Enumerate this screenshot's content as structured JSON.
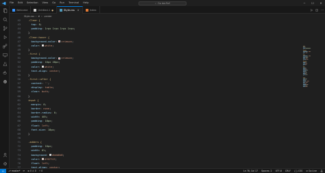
{
  "titlebar": {
    "menu": [
      "File",
      "Edit",
      "Selection",
      "View",
      "Go",
      "Run",
      "Terminal",
      "Help"
    ],
    "search_placeholder": "Go dar.Ref"
  },
  "tabs": [
    {
      "label": "Welcome",
      "color": "#3794ff",
      "modified": false,
      "active": false
    },
    {
      "label": "Untitled-1",
      "color": "#cccccc",
      "modified": true,
      "active": false
    },
    {
      "label": "Style.css",
      "color": "#519aba",
      "modified": false,
      "active": true
    },
    {
      "label": "Index",
      "color": "#e37933",
      "modified": false,
      "active": false
    }
  ],
  "breadcrumb": [
    "Style.css",
    "#",
    ".center"
  ],
  "editor": {
    "current_line": 78,
    "lines": [
      {
        "n": 42,
        "tokens": [
          [
            "sel",
            ".Clear {"
          ]
        ]
      },
      {
        "n": 43,
        "tokens": [
          [
            "prop",
            "  top"
          ],
          [
            "punc",
            ": "
          ],
          [
            "num",
            "0"
          ],
          [
            "punc",
            ";"
          ]
        ]
      },
      {
        "n": 44,
        "tokens": [
          [
            "prop",
            "  padding"
          ],
          [
            "punc",
            ": "
          ],
          [
            "num",
            "1rpx 1rpx 1rpx 1rpx"
          ],
          [
            "punc",
            ";"
          ]
        ]
      },
      {
        "n": 45,
        "tokens": [
          [
            "punc",
            "}"
          ]
        ]
      },
      {
        "n": 46,
        "tokens": [
          [
            "sel",
            ".Clear:hover {"
          ]
        ]
      },
      {
        "n": 47,
        "tokens": [
          [
            "prop",
            "  background-color"
          ],
          [
            "punc",
            ": "
          ],
          [
            "swatch",
            "#e13c3c"
          ],
          [
            "val",
            "crimson"
          ],
          [
            "punc",
            ";"
          ]
        ]
      },
      {
        "n": 48,
        "tokens": [
          [
            "prop",
            "  color"
          ],
          [
            "punc",
            ": "
          ],
          [
            "swatch",
            "#ffffff"
          ],
          [
            "val",
            "white"
          ],
          [
            "punc",
            ";"
          ]
        ]
      },
      {
        "n": 49,
        "tokens": [
          [
            "punc",
            "}"
          ]
        ]
      },
      {
        "n": 50,
        "tokens": [
          [
            "sel",
            ".first {"
          ]
        ]
      },
      {
        "n": 51,
        "tokens": [
          [
            "prop",
            "  background-color"
          ],
          [
            "punc",
            ": "
          ],
          [
            "swatch",
            "#e13c3c"
          ],
          [
            "val",
            "crimson"
          ],
          [
            "punc",
            ";"
          ]
        ]
      },
      {
        "n": 52,
        "tokens": [
          [
            "prop",
            "  padding"
          ],
          [
            "punc",
            ": "
          ],
          [
            "num",
            "10px 40px"
          ],
          [
            "punc",
            ";"
          ]
        ]
      },
      {
        "n": 53,
        "tokens": [
          [
            "prop",
            "  color"
          ],
          [
            "punc",
            ": "
          ],
          [
            "swatch",
            "#ffffff"
          ],
          [
            "val",
            "white"
          ],
          [
            "punc",
            ";"
          ]
        ]
      },
      {
        "n": 54,
        "tokens": [
          [
            "prop",
            "  text-align"
          ],
          [
            "punc",
            ": "
          ],
          [
            "val",
            "center"
          ],
          [
            "punc",
            ";"
          ]
        ]
      },
      {
        "n": 55,
        "tokens": [
          [
            "punc",
            "}"
          ]
        ]
      },
      {
        "n": 56,
        "tokens": [
          [
            "sel",
            ".first::after {"
          ]
        ]
      },
      {
        "n": 57,
        "tokens": [
          [
            "prop",
            "  content"
          ],
          [
            "punc",
            ": "
          ],
          [
            "val",
            "''"
          ],
          [
            "punc",
            ";"
          ]
        ]
      },
      {
        "n": 58,
        "tokens": [
          [
            "prop",
            "  display"
          ],
          [
            "punc",
            ": "
          ],
          [
            "val",
            "table"
          ],
          [
            "punc",
            ";"
          ]
        ]
      },
      {
        "n": 59,
        "tokens": [
          [
            "prop",
            "  clear"
          ],
          [
            "punc",
            ": "
          ],
          [
            "val",
            "both"
          ],
          [
            "punc",
            ";"
          ]
        ]
      },
      {
        "n": 60,
        "tokens": [
          [
            "punc",
            "}"
          ]
        ]
      },
      {
        "n": 61,
        "tokens": [
          [
            "sel",
            "input {"
          ]
        ]
      },
      {
        "n": 62,
        "tokens": [
          [
            "prop",
            "  margin"
          ],
          [
            "punc",
            ": "
          ],
          [
            "num",
            "0"
          ],
          [
            "punc",
            ";"
          ]
        ]
      },
      {
        "n": 63,
        "tokens": [
          [
            "prop",
            "  border"
          ],
          [
            "punc",
            ": "
          ],
          [
            "val",
            "none"
          ],
          [
            "punc",
            ";"
          ]
        ]
      },
      {
        "n": 64,
        "tokens": [
          [
            "prop",
            "  border-radius"
          ],
          [
            "punc",
            ": "
          ],
          [
            "num",
            "0"
          ],
          [
            "punc",
            ";"
          ]
        ]
      },
      {
        "n": 65,
        "tokens": [
          [
            "prop",
            "  width"
          ],
          [
            "punc",
            ": "
          ],
          [
            "num",
            "40%"
          ],
          [
            "punc",
            ";"
          ]
        ]
      },
      {
        "n": 66,
        "tokens": [
          [
            "prop",
            "  padding"
          ],
          [
            "punc",
            ": "
          ],
          [
            "num",
            "18px"
          ],
          [
            "punc",
            ";"
          ]
        ]
      },
      {
        "n": 67,
        "tokens": [
          [
            "prop",
            "  float"
          ],
          [
            "punc",
            ": "
          ],
          [
            "val",
            "left"
          ],
          [
            "punc",
            ";"
          ]
        ]
      },
      {
        "n": 68,
        "tokens": [
          [
            "prop",
            "  font-size"
          ],
          [
            "punc",
            ": "
          ],
          [
            "num",
            "18px"
          ],
          [
            "punc",
            ";"
          ]
        ]
      },
      {
        "n": 69,
        "tokens": [
          [
            "punc",
            "}"
          ]
        ]
      },
      {
        "n": 70,
        "tokens": []
      },
      {
        "n": 71,
        "tokens": [
          [
            "sel",
            ".adders {"
          ]
        ]
      },
      {
        "n": 72,
        "tokens": [
          [
            "prop",
            "  padding"
          ],
          [
            "punc",
            ": "
          ],
          [
            "num",
            "10px"
          ],
          [
            "punc",
            ";"
          ]
        ]
      },
      {
        "n": 73,
        "tokens": [
          [
            "prop",
            "  width"
          ],
          [
            "punc",
            ": "
          ],
          [
            "num",
            "6%"
          ],
          [
            "punc",
            ";"
          ]
        ]
      },
      {
        "n": 74,
        "tokens": [
          [
            "prop",
            "  background"
          ],
          [
            "punc",
            ": "
          ],
          [
            "swatch",
            "#ddd6d6"
          ],
          [
            "val",
            "#ddd6d6"
          ],
          [
            "punc",
            ";"
          ]
        ]
      },
      {
        "n": 75,
        "tokens": [
          [
            "prop",
            "  color"
          ],
          [
            "punc",
            ": "
          ],
          [
            "swatch",
            "#f07f4f"
          ],
          [
            "val",
            "#f07f4f"
          ],
          [
            "punc",
            ";"
          ]
        ]
      },
      {
        "n": 76,
        "tokens": [
          [
            "prop",
            "  float"
          ],
          [
            "punc",
            ": "
          ],
          [
            "val",
            "left"
          ],
          [
            "punc",
            ";"
          ]
        ]
      },
      {
        "n": 77,
        "tokens": [
          [
            "prop",
            "  text-align"
          ],
          [
            "punc",
            ": "
          ],
          [
            "val",
            "center"
          ],
          [
            "punc",
            ";"
          ]
        ]
      },
      {
        "n": 78,
        "tokens": [
          [
            "prop",
            "  font-size"
          ],
          [
            "punc",
            ": "
          ],
          [
            "num",
            "18px"
          ],
          [
            "punc",
            ";"
          ]
        ]
      },
      {
        "n": 79,
        "tokens": [
          [
            "prop",
            "  cursor"
          ],
          [
            "punc",
            ": "
          ],
          [
            "val",
            "pointer"
          ],
          [
            "punc",
            ";"
          ]
        ]
      }
    ]
  },
  "statusbar": {
    "branch": "master*",
    "sync": "⟳",
    "problems": "⊗ 0 ⚠ 0",
    "ports": "⚡ 0",
    "position": "Ln 78, Col 17",
    "spaces": "Spaces: 2",
    "encoding": "UTF-8",
    "eol": "CRLF",
    "language": "{ } CSS",
    "golive": "⊘ Go Live"
  }
}
